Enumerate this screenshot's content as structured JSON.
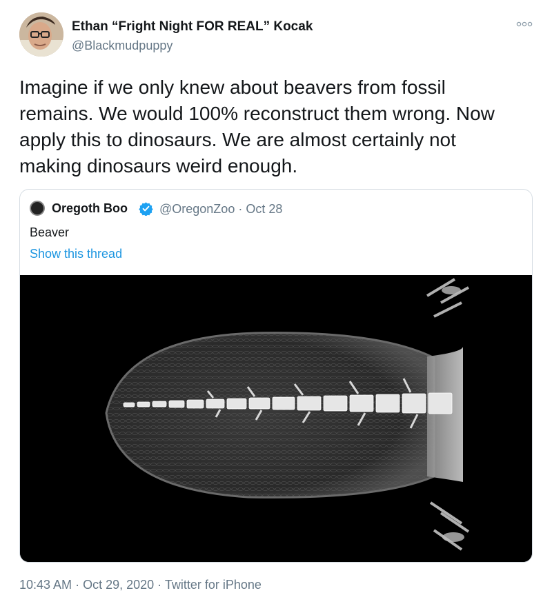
{
  "tweet": {
    "author": {
      "display_name": "Ethan “Fright Night FOR REAL” Kocak",
      "handle": "@Blackmudpuppy"
    },
    "menu_icon": "more-dots-icon",
    "text": "Imagine if we only knew about beavers from fossil\nremains. We would 100% reconstruct them wrong. Now\napply this to dinosaurs. We are almost certainly not\nmaking dinosaurs weird enough.",
    "time": "10:43 AM",
    "date": "Oct 29, 2020",
    "source": "Twitter for iPhone",
    "separator": " · "
  },
  "quote": {
    "author": {
      "display_name": "Oregoth Boo",
      "handle": "@OregonZoo",
      "verified": true
    },
    "separator": " · ",
    "date": "Oct 28",
    "text": "Beaver",
    "thread_link": "Show this thread",
    "media_description_icon": "xray-beaver-tail-image"
  },
  "colors": {
    "text_primary": "#14171a",
    "text_secondary": "#657786",
    "link": "#1b95e0",
    "verified": "#1da1f2",
    "border": "#d6dde3"
  }
}
